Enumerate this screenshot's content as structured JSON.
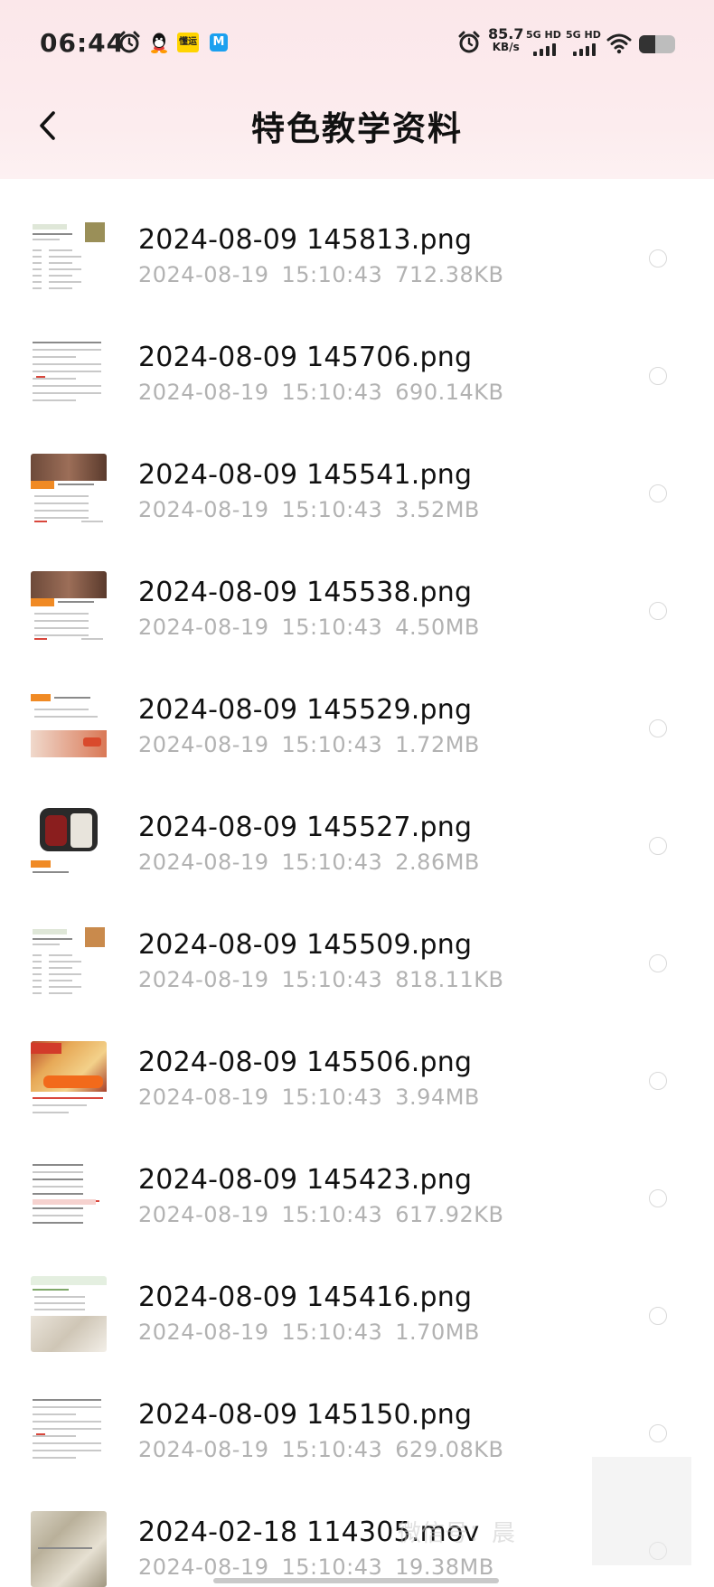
{
  "status_bar": {
    "time": "06:44",
    "left_icons": [
      "alarm-icon",
      "qq-icon",
      "app-icon",
      "app-icon"
    ],
    "app_a_text": "懂运",
    "app_b_text": "M",
    "net_speed_value": "85.7",
    "net_speed_unit": "KB/s",
    "signal_1": "5G HD",
    "signal_2": "5G HD",
    "wifi": "wifi-icon",
    "battery_level": 0.45
  },
  "header": {
    "back_icon": "chevron-left-icon",
    "title": "特色教学资料"
  },
  "files": [
    {
      "name": "2024-08-09 145813.png",
      "date": "2024-08-19",
      "time": "15:10:43",
      "size": "712.38KB",
      "thumb": "doc-table"
    },
    {
      "name": "2024-08-09 145706.png",
      "date": "2024-08-19",
      "time": "15:10:43",
      "size": "690.14KB",
      "thumb": "doc-text"
    },
    {
      "name": "2024-08-09 145541.png",
      "date": "2024-08-19",
      "time": "15:10:43",
      "size": "3.52MB",
      "thumb": "product-brown"
    },
    {
      "name": "2024-08-09 145538.png",
      "date": "2024-08-19",
      "time": "15:10:43",
      "size": "4.50MB",
      "thumb": "product-brown"
    },
    {
      "name": "2024-08-09 145529.png",
      "date": "2024-08-19",
      "time": "15:10:43",
      "size": "1.72MB",
      "thumb": "product-orange"
    },
    {
      "name": "2024-08-09 145527.png",
      "date": "2024-08-19",
      "time": "15:10:43",
      "size": "2.86MB",
      "thumb": "product-box"
    },
    {
      "name": "2024-08-09 145509.png",
      "date": "2024-08-19",
      "time": "15:10:43",
      "size": "818.11KB",
      "thumb": "doc-table-food"
    },
    {
      "name": "2024-08-09 145506.png",
      "date": "2024-08-19",
      "time": "15:10:43",
      "size": "3.94MB",
      "thumb": "product-food"
    },
    {
      "name": "2024-08-09 145423.png",
      "date": "2024-08-19",
      "time": "15:10:43",
      "size": "617.92KB",
      "thumb": "doc-list-red"
    },
    {
      "name": "2024-08-09 145416.png",
      "date": "2024-08-19",
      "time": "15:10:43",
      "size": "1.70MB",
      "thumb": "doc-photo"
    },
    {
      "name": "2024-08-09 145150.png",
      "date": "2024-08-19",
      "time": "15:10:43",
      "size": "629.08KB",
      "thumb": "doc-text"
    },
    {
      "name": "2024-02-18 114305.mov",
      "date": "2024-08-19",
      "time": "15:10:43",
      "size": "19.38MB",
      "thumb": "video"
    }
  ],
  "watermark_text": "微信号：晨"
}
